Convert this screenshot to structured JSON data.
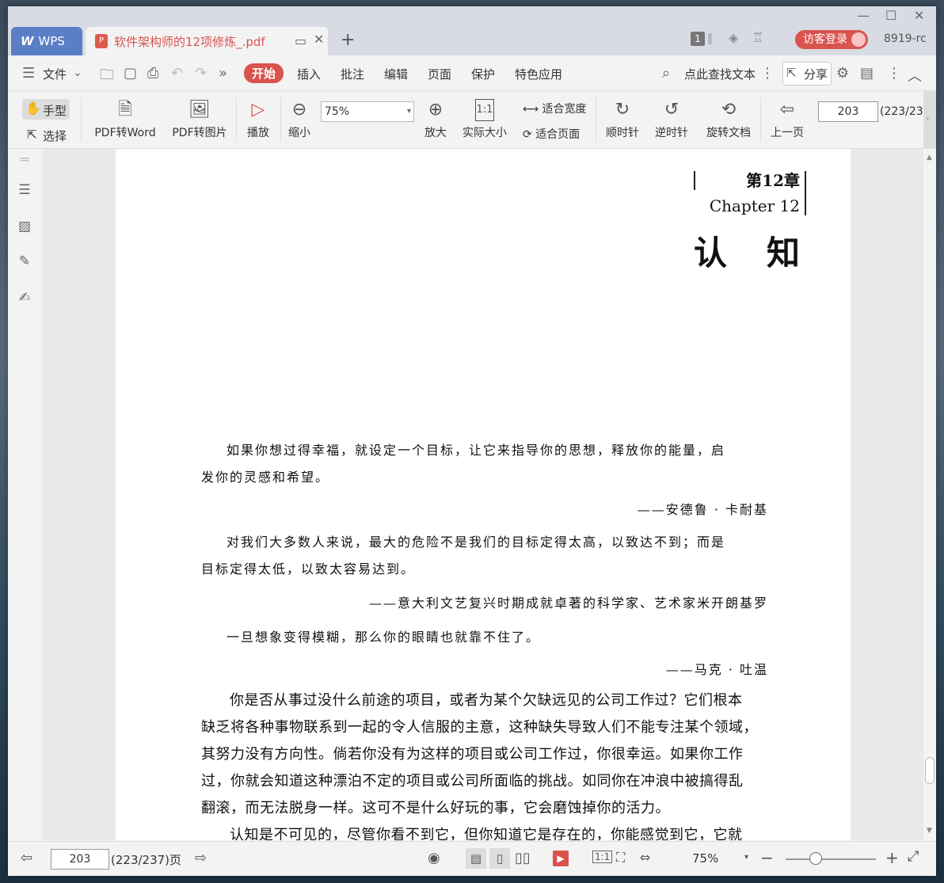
{
  "titlebar": {
    "wps_tab": "WPS",
    "file_tab": "软件架构师的12项修炼_.pdf",
    "badge": "1",
    "login": "访客登录",
    "version": "8919-rc"
  },
  "menu": {
    "file": "文件",
    "items": [
      "开始",
      "插入",
      "批注",
      "编辑",
      "页面",
      "保护",
      "特色应用"
    ],
    "search": "点此查找文本",
    "share": "分享"
  },
  "toolbar": {
    "hand": "手型",
    "select": "选择",
    "pdf2word": "PDF转Word",
    "pdf2img": "PDF转图片",
    "play": "播放",
    "zoom_out": "缩小",
    "zoom_value": "75%",
    "zoom_in": "放大",
    "actual": "实际大小",
    "fit_width": "适合宽度",
    "fit_page": "适合页面",
    "cw": "顺时针",
    "ccw": "逆时针",
    "rotate": "旋转文档",
    "prev": "上一页",
    "page": "203",
    "page_total": "(223/23"
  },
  "doc": {
    "chapter_cn": "第12章",
    "chapter_en": "Chapter 12",
    "title": "认知",
    "q1_line1": "如果你想过得幸福，就设定一个目标，让它来指导你的思想，释放你的能量，启",
    "q1_line2": "发你的灵感和希望。",
    "q1_attr": "——安德鲁 · 卡耐基",
    "q2_line1": "对我们大多数人来说，最大的危险不是我们的目标定得太高，以致达不到；而是",
    "q2_line2": "目标定得太低，以致太容易达到。",
    "q2_attr": "——意大利文艺复兴时期成就卓著的科学家、艺术家米开朗基罗",
    "q3_line1": "一旦想象变得模糊，那么你的眼睛也就靠不住了。",
    "q3_attr": "——马克 · 吐温",
    "body_lines": [
      "你是否从事过没什么前途的项目，或者为某个欠缺远见的公司工作过？它们根本",
      "缺乏将各种事物联系到一起的令人信服的主意，这种缺失导致人们不能专注某个领域，",
      "其努力没有方向性。倘若你没有为这样的项目或公司工作过，你很幸运。如果你工作",
      "过，你就会知道这种漂泊不定的项目或公司所面临的挑战。如同你在冲浪中被搞得乱",
      "翻滚，而无法脱身一样。这可不是什么好玩的事，它会磨蚀掉你的活力。",
      "认知是不可见的，尽管你看不到它，但你知道它是存在的，你能感觉到它，它就"
    ]
  },
  "status": {
    "page": "203",
    "page_total": "(223/237)页",
    "zoom": "75%",
    "zoom_level": 0.38
  }
}
